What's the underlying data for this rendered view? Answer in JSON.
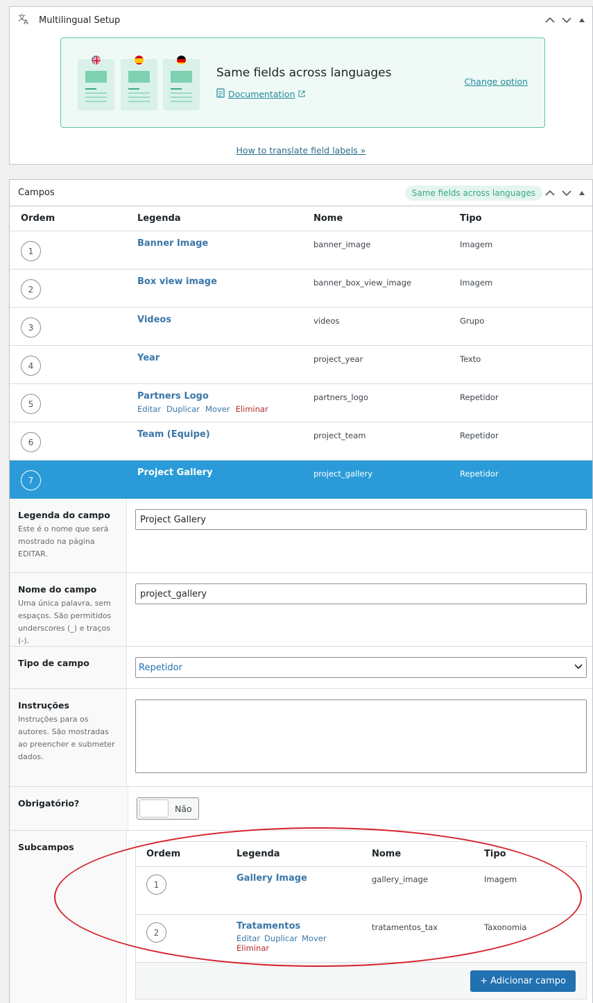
{
  "multilingual": {
    "title": "Multilingual Setup",
    "card_title": "Same fields across languages",
    "documentation_link": "Documentation",
    "change_option_link": "Change option",
    "how_to_link": "How to translate field labels »"
  },
  "campos": {
    "title": "Campos",
    "badge": "Same fields across languages",
    "headers": {
      "ordem": "Ordem",
      "legenda": "Legenda",
      "nome": "Nome",
      "tipo": "Tipo"
    },
    "rows": [
      {
        "order": "1",
        "label": "Banner Image",
        "name": "banner_image",
        "type": "Imagem"
      },
      {
        "order": "2",
        "label": "Box view image",
        "name": "banner_box_view_image",
        "type": "Imagem"
      },
      {
        "order": "3",
        "label": "Videos",
        "name": "videos",
        "type": "Grupo"
      },
      {
        "order": "4",
        "label": "Year",
        "name": "project_year",
        "type": "Texto"
      },
      {
        "order": "5",
        "label": "Partners Logo",
        "name": "partners_logo",
        "type": "Repetidor"
      },
      {
        "order": "6",
        "label": "Team (Equipe)",
        "name": "project_team",
        "type": "Repetidor"
      },
      {
        "order": "7",
        "label": "Project Gallery",
        "name": "project_gallery",
        "type": "Repetidor"
      }
    ],
    "row_actions": {
      "edit": "Editar",
      "duplicate": "Duplicar",
      "move": "Mover",
      "delete": "Eliminar"
    }
  },
  "settings": {
    "label_title": "Legenda do campo",
    "label_desc": "Este é o nome que será mostrado na página EDITAR.",
    "label_value": "Project Gallery",
    "name_title": "Nome do campo",
    "name_desc": "Uma única palavra, sem espaços. São permitidos underscores (_) e traços (-).",
    "name_value": "project_gallery",
    "type_title": "Tipo de campo",
    "type_value": "Repetidor",
    "instructions_title": "Instruções",
    "instructions_desc": "Instruções para os autores. São mostradas ao preencher e submeter dados.",
    "required_title": "Obrigatório?",
    "required_value": "Não",
    "subfields_title": "Subcampos"
  },
  "subfields": {
    "headers": {
      "ordem": "Ordem",
      "legenda": "Legenda",
      "nome": "Nome",
      "tipo": "Tipo"
    },
    "rows": [
      {
        "order": "1",
        "label": "Gallery Image",
        "name": "gallery_image",
        "type": "Imagem"
      },
      {
        "order": "2",
        "label": "Tratamentos",
        "name": "tratamentos_tax",
        "type": "Taxonomia"
      }
    ],
    "add_button": "+ Adicionar campo"
  },
  "colors": {
    "accent": "#2a9bd8",
    "button": "#2271b1",
    "annotation": "#d5212a",
    "ml_border": "#5fc4a4"
  }
}
